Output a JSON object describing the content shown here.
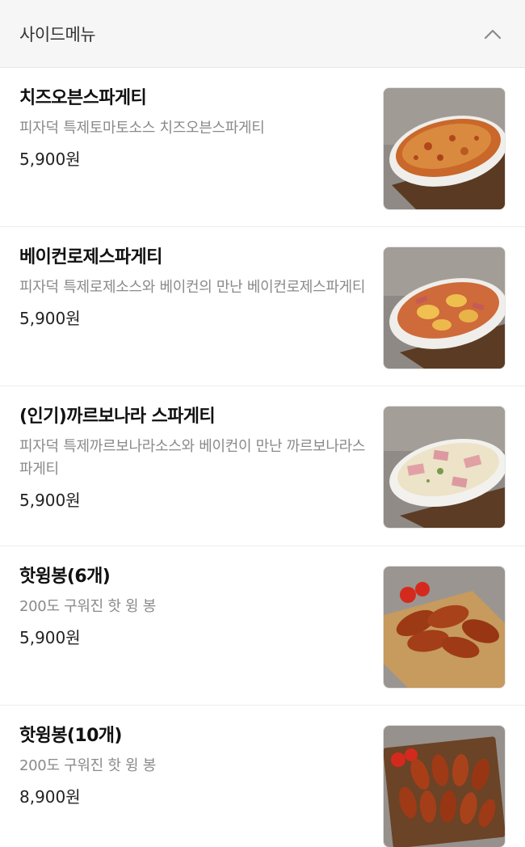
{
  "section": {
    "title": "사이드메뉴",
    "collapse_icon": "chevron-up-icon"
  },
  "items": [
    {
      "name": "치즈오븐스파게티",
      "description": "피자덕 특제토마토소스 치즈오븐스파게티",
      "price": "5,900원",
      "image": "cheese-oven-spaghetti-photo"
    },
    {
      "name": "베이컨로제스파게티",
      "description": "피자덕 특제로제소스와 베이컨의 만난 베이컨로제스파게티",
      "price": "5,900원",
      "image": "bacon-rose-spaghetti-photo"
    },
    {
      "name": "(인기)까르보나라 스파게티",
      "description": "피자덕 특제까르보나라소스와 베이컨이 만난 까르보나라스파게티",
      "price": "5,900원",
      "image": "carbonara-spaghetti-photo"
    },
    {
      "name": "핫윙봉(6개)",
      "description": "200도 구워진 핫 윙 봉",
      "price": "5,900원",
      "image": "hot-wings-6-photo"
    },
    {
      "name": "핫윙봉(10개)",
      "description": "200도 구워진 핫 윙 봉",
      "price": "8,900원",
      "image": "hot-wings-10-photo"
    }
  ]
}
